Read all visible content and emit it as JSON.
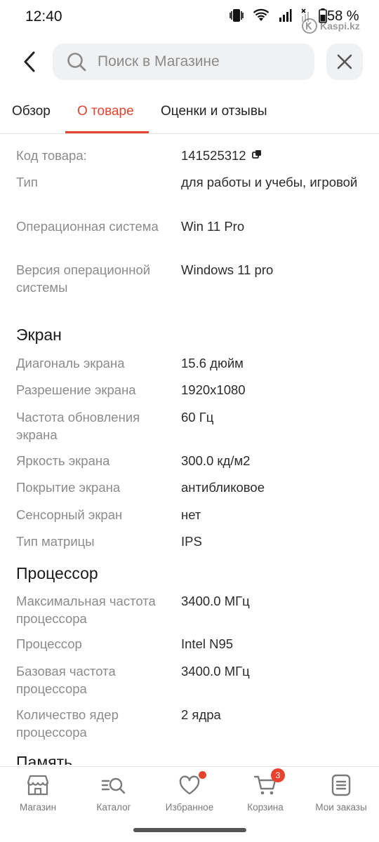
{
  "status_bar": {
    "time": "12:40",
    "battery_percent": "58 %",
    "icons": [
      "vibrate-icon",
      "wifi-icon",
      "signal-icon",
      "signal-off-icon",
      "battery-icon"
    ]
  },
  "watermark": {
    "text": "Kaspi.kz"
  },
  "header": {
    "search_placeholder": "Поиск в Магазине"
  },
  "tabs": [
    {
      "label": "Обзор",
      "active": false
    },
    {
      "label": "О товаре",
      "active": true
    },
    {
      "label": "Оценки и отзывы",
      "active": false
    }
  ],
  "specs": {
    "general": [
      {
        "label": "Код товара:",
        "value": "141525312"
      },
      {
        "label": "Тип",
        "value": "для работы и учебы, игровой"
      },
      {
        "label": "Операционная система",
        "value": "Win 11 Pro"
      },
      {
        "label": "Версия операционной системы",
        "value": "Windows 11 pro"
      }
    ],
    "screen_title": "Экран",
    "screen": [
      {
        "label": "Диагональ экрана",
        "value": "15.6 дюйм"
      },
      {
        "label": "Разрешение экрана",
        "value": "1920x1080"
      },
      {
        "label": "Частота обновления экрана",
        "value": "60 Гц"
      },
      {
        "label": "Яркость экрана",
        "value": "300.0 кд/м2"
      },
      {
        "label": "Покрытие экрана",
        "value": "антибликовое"
      },
      {
        "label": "Сенсорный экран",
        "value": "нет"
      },
      {
        "label": "Тип матрицы",
        "value": "IPS"
      }
    ],
    "cpu_title": "Процессор",
    "cpu": [
      {
        "label": "Максимальная частота процессора",
        "value": "3400.0 МГц"
      },
      {
        "label": "Процессор",
        "value": "Intel N95"
      },
      {
        "label": "Базовая частота процессора",
        "value": "3400.0 МГц"
      },
      {
        "label": "Количество ядер процессора",
        "value": "2 ядра"
      }
    ],
    "memory_title": "Память"
  },
  "bottom_nav": [
    {
      "label": "Магазин",
      "icon": "store-icon"
    },
    {
      "label": "Каталог",
      "icon": "catalog-search-icon"
    },
    {
      "label": "Избранное",
      "icon": "heart-icon",
      "dot": true
    },
    {
      "label": "Корзина",
      "icon": "cart-icon",
      "badge": "3"
    },
    {
      "label": "Мои заказы",
      "icon": "orders-icon"
    }
  ],
  "colors": {
    "accent": "#e8432f",
    "label_gray": "#8b8b8b",
    "search_bg": "#f0f1f3"
  }
}
